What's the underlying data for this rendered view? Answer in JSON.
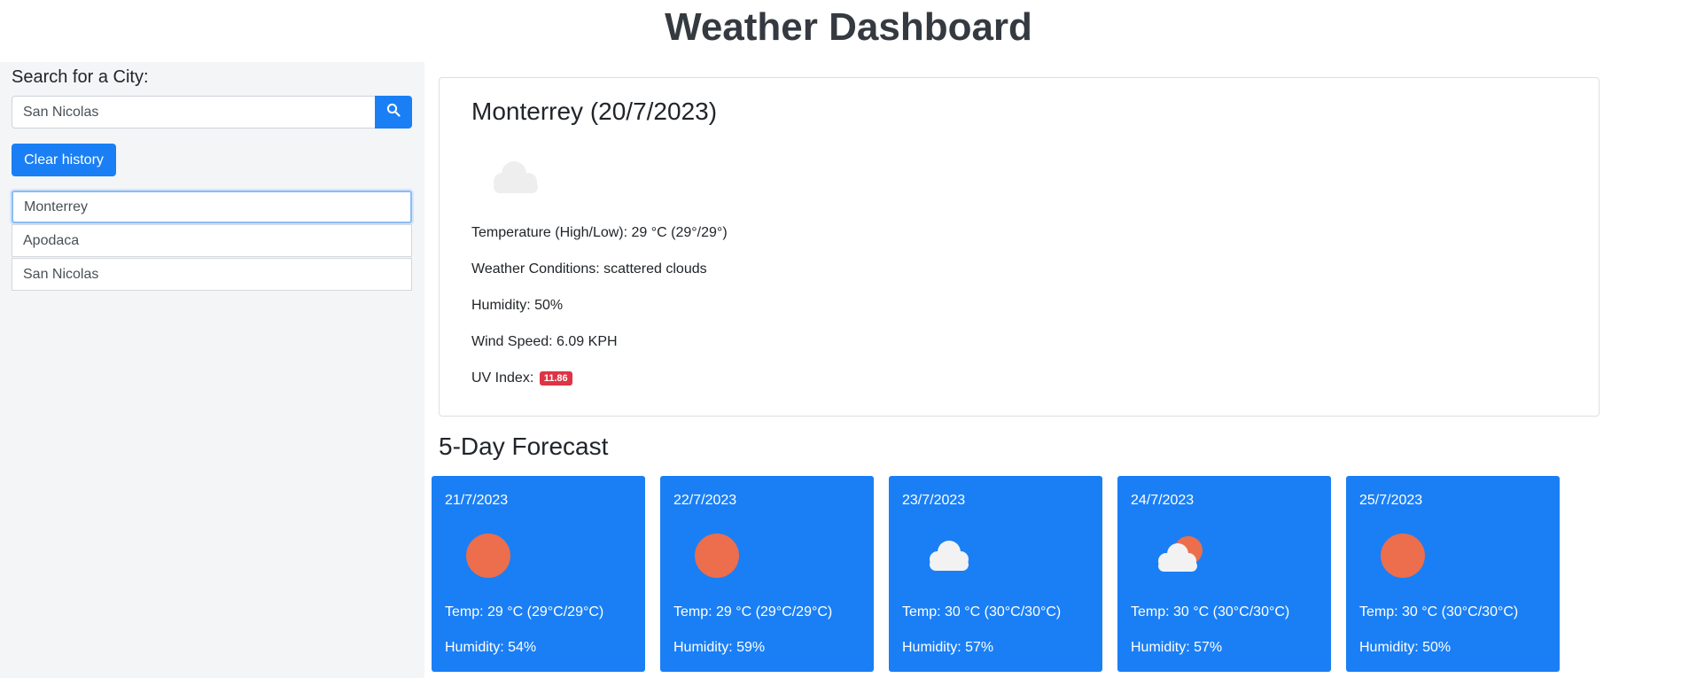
{
  "header": {
    "title": "Weather Dashboard"
  },
  "search": {
    "label": "Search for a City:",
    "value": "San Nicolas",
    "button_icon": "search-icon"
  },
  "history": {
    "clear_label": "Clear history",
    "items": [
      "Monterrey",
      "Apodaca",
      "San Nicolas"
    ],
    "active": "Monterrey"
  },
  "current": {
    "title": "Monterrey (20/7/2023)",
    "icon": "cloud-icon",
    "temperature": "Temperature (High/Low): 29 °C (29°/29°)",
    "conditions": "Weather Conditions: scattered clouds",
    "humidity": "Humidity: 50%",
    "wind": "Wind Speed: 6.09 KPH",
    "uv_label": "UV Index:",
    "uv_value": "11.86",
    "uv_color": "#dc3545"
  },
  "forecast": {
    "title": "5-Day Forecast",
    "days": [
      {
        "date": "21/7/2023",
        "icon": "sun-icon",
        "temp": "Temp: 29 °C (29°C/29°C)",
        "humidity": "Humidity: 54%"
      },
      {
        "date": "22/7/2023",
        "icon": "sun-icon",
        "temp": "Temp: 29 °C (29°C/29°C)",
        "humidity": "Humidity: 59%"
      },
      {
        "date": "23/7/2023",
        "icon": "cloud-icon",
        "temp": "Temp: 30 °C (30°C/30°C)",
        "humidity": "Humidity: 57%"
      },
      {
        "date": "24/7/2023",
        "icon": "partly-cloudy-icon",
        "temp": "Temp: 30 °C (30°C/30°C)",
        "humidity": "Humidity: 57%"
      },
      {
        "date": "25/7/2023",
        "icon": "sun-icon",
        "temp": "Temp: 30 °C (30°C/30°C)",
        "humidity": "Humidity: 50%"
      }
    ]
  },
  "colors": {
    "accent": "#1a7ff5",
    "sun": "#ec6e4c",
    "uv_badge": "#dc3545",
    "sidebar_bg": "#f4f5f7"
  }
}
